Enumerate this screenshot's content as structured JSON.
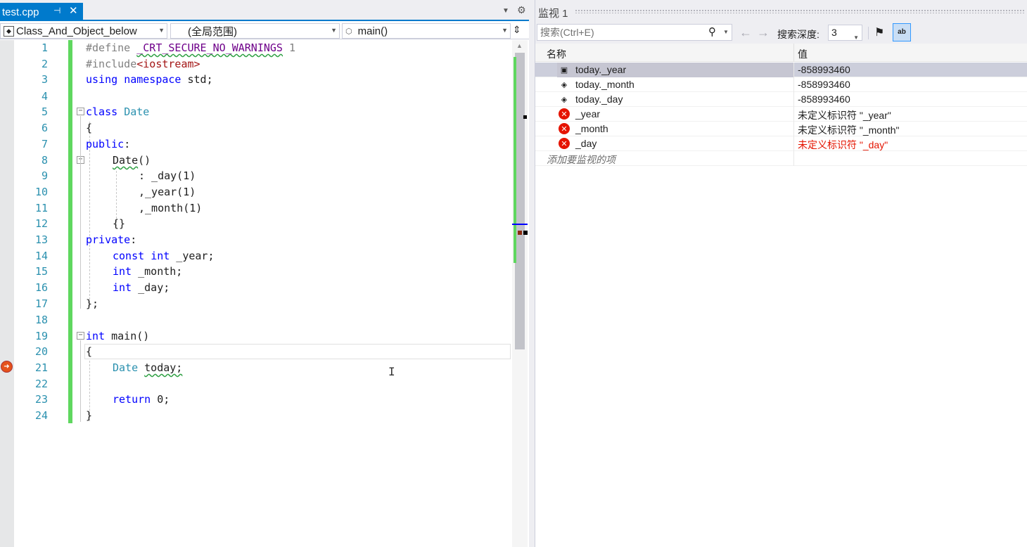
{
  "editor": {
    "tab": {
      "filename": "test.cpp",
      "pin": "⊣",
      "close": "✕"
    },
    "nav": {
      "class_scope": "Class_And_Object_below",
      "global_scope": "(全局范围)",
      "member": "main()"
    },
    "line_numbers": [
      "1",
      "2",
      "3",
      "4",
      "5",
      "6",
      "7",
      "8",
      "9",
      "10",
      "11",
      "12",
      "13",
      "14",
      "15",
      "16",
      "17",
      "18",
      "19",
      "20",
      "21",
      "22",
      "23",
      "24"
    ],
    "code": {
      "l1": {
        "a": "#define ",
        "b": "_CRT_SECURE_NO_WARNINGS",
        "c": " 1"
      },
      "l2": {
        "a": "#include",
        "b": "<iostream>"
      },
      "l3": {
        "a": "using",
        "b": " ",
        "c": "namespace",
        "d": " std;"
      },
      "l5": {
        "a": "class",
        "b": " ",
        "c": "Date"
      },
      "l6": "{",
      "l7": {
        "a": "public",
        "b": ":"
      },
      "l8": {
        "a": "Date",
        "b": "()"
      },
      "l9": ": _day(1)",
      "l10": ",_year(1)",
      "l11": ",_month(1)",
      "l12": "{}",
      "l13": {
        "a": "private",
        "b": ":"
      },
      "l14": {
        "a": "const",
        "b": " ",
        "c": "int",
        "d": " _year;"
      },
      "l15": {
        "a": "int",
        "b": " _month;"
      },
      "l16": {
        "a": "int",
        "b": " _day;"
      },
      "l17": "};",
      "l19": {
        "a": "int",
        "b": " main()"
      },
      "l20": "{",
      "l21": {
        "a": "Date",
        "b": " ",
        "c": "today;"
      },
      "l23": {
        "a": "return",
        "b": " 0;"
      },
      "l24": "}"
    }
  },
  "watch": {
    "title": "监视 1",
    "search_placeholder": "搜索(Ctrl+E)",
    "depth_label": "搜索深度:",
    "depth_value": "3",
    "columns": {
      "name": "名称",
      "value": "值"
    },
    "rows": [
      {
        "name": "today._year",
        "value": "-858993460",
        "icon": "field-icon"
      },
      {
        "name": "today._month",
        "value": "-858993460",
        "icon": "field-icon"
      },
      {
        "name": "today._day",
        "value": "-858993460",
        "icon": "field-icon"
      },
      {
        "name": "_year",
        "value": "未定义标识符 \"_year\"",
        "icon": "error-icon"
      },
      {
        "name": "_month",
        "value": "未定义标识符 \"_month\"",
        "icon": "error-icon"
      },
      {
        "name": "_day",
        "value": "未定义标识符 \"_day\"",
        "icon": "error-icon"
      }
    ],
    "add_item_placeholder": "添加要监视的项"
  },
  "colors": {
    "accent": "#007acc",
    "line_number": "#2b91af",
    "keyword": "#0000ff",
    "type": "#2b91af",
    "error": "#e51400",
    "change_bar": "#5fd75f"
  }
}
